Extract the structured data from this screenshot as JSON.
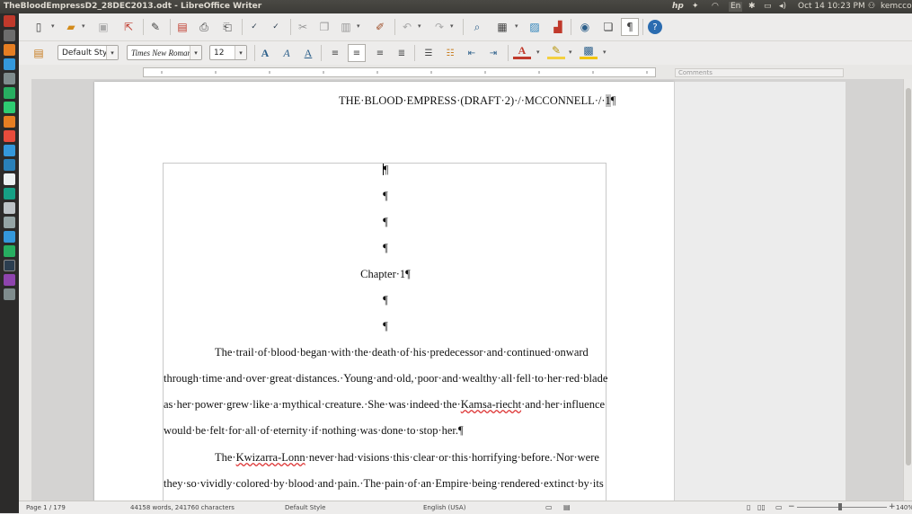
{
  "window": {
    "title": "TheBloodEmpressD2_28DEC2013.odt - LibreOffice Writer"
  },
  "tray": {
    "hp": "hp",
    "keyboard": "En",
    "clock": "Oct 14 10:23 PM",
    "user": "kemcco"
  },
  "formatting": {
    "paragraph_style": "Default Style",
    "font_name": "Times New Roman",
    "font_size": "12"
  },
  "comments_header": "Comments",
  "document": {
    "header_main": "THE·BLOOD·EMPRESS·(DRAFT·2)·/·MCCONNELL·/·",
    "header_page_field": "1",
    "header_pilcrow": "¶",
    "pilcrow": "¶",
    "chapter_heading": "Chapter·1¶",
    "paragraph1": {
      "part1": "The·trail·of·blood·began·with·the·death·of·his·predecessor·and·continued·onward through·time·and·over·great·distances.·Young·and·old,·poor·and·wealthy·all·fell·to·her·red·blade as·her·power·grew·like·a·mythical·creature.·She·was·indeed·the·",
      "squiggle": "Kamsa-riecht",
      "part2": "·and·her·influence would·be·felt·for·all·of·eternity·if·nothing·was·done·to·stop·her.¶"
    },
    "paragraph2": {
      "part1": "The·",
      "squiggle": "Kwizarra-Lonn",
      "part2": "·never·had·visions·this·clear·or·this·horrifying·before.·Nor·were they·so·vividly·colored·by·blood·and·pain.·The·pain·of·an·Empire·being·rendered·extinct·by·its"
    }
  },
  "status": {
    "page": "Page 1 / 179",
    "words": "44158 words, 241760 characters",
    "style": "Default Style",
    "language": "English (USA)",
    "zoom": "140%"
  }
}
